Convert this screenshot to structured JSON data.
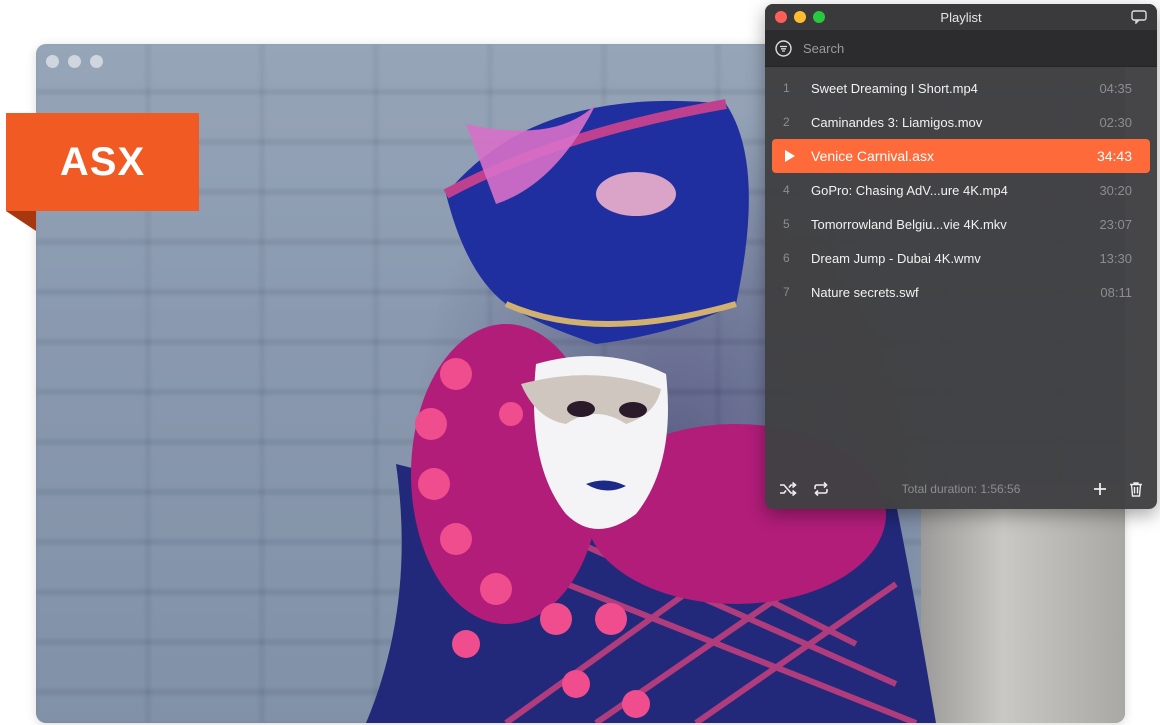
{
  "badge": {
    "label": "ASX"
  },
  "playlist": {
    "title": "Playlist",
    "search_placeholder": "Search",
    "items": [
      {
        "index": "1",
        "name": "Sweet Dreaming I Short.mp4",
        "duration": "04:35"
      },
      {
        "index": "2",
        "name": "Caminandes 3: Liamigos.mov",
        "duration": "02:30"
      },
      {
        "index": "",
        "name": "Venice Carnival.asx",
        "duration": "34:43",
        "playing": true
      },
      {
        "index": "4",
        "name": "GoPro: Chasing AdV...ure 4K.mp4",
        "duration": "30:20"
      },
      {
        "index": "5",
        "name": "Tomorrowland Belgiu...vie 4K.mkv",
        "duration": "23:07"
      },
      {
        "index": "6",
        "name": "Dream Jump - Dubai 4K.wmv",
        "duration": "13:30"
      },
      {
        "index": "7",
        "name": "Nature secrets.swf",
        "duration": "08:11"
      }
    ],
    "total_duration": "Total duration: 1:56:56"
  },
  "colors": {
    "accent": "#ff6a3a",
    "badge": "#f25a24",
    "panel": "#404042"
  },
  "icons": [
    "list-icon",
    "chat-icon",
    "play-icon",
    "shuffle-icon",
    "repeat-icon",
    "add-icon",
    "trash-icon"
  ]
}
